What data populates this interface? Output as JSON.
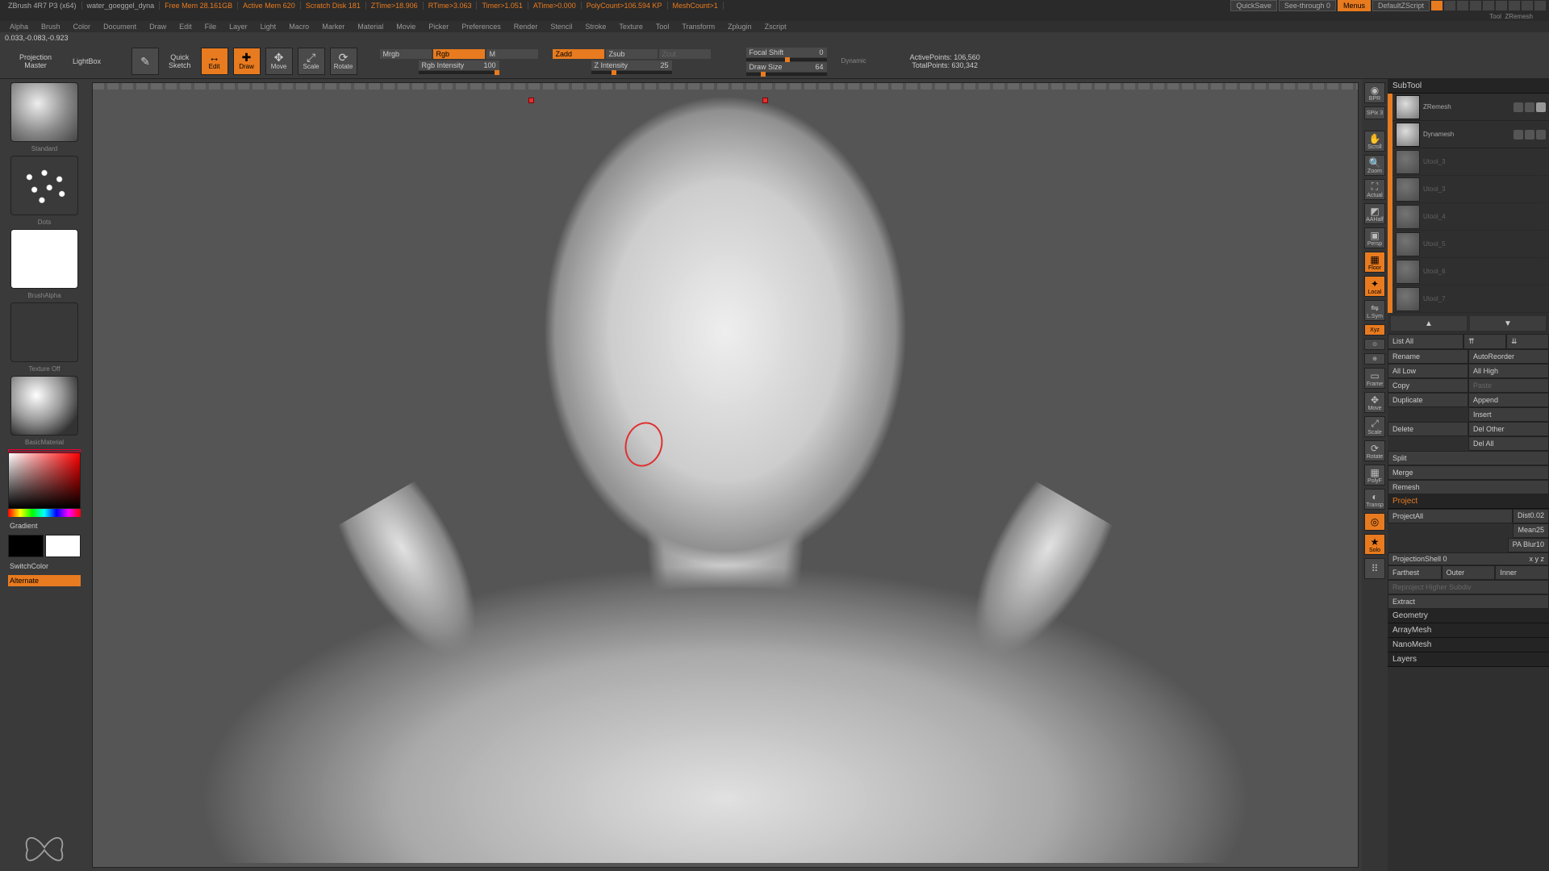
{
  "titlebar": {
    "app": "ZBrush 4R7 P3 (x64)",
    "doc": "water_goeggel_dyna",
    "freemem": "Free Mem 28.161GB",
    "activemem": "Active Mem 620",
    "scratch": "Scratch Disk 181",
    "ztime": "ZTime>18.906",
    "rtime": "RTime>3.063",
    "timer": "Timer>1.051",
    "atime": "ATime>0.000",
    "polycount": "PolyCount>106.594 KP",
    "meshcount": "MeshCount>1",
    "quicksave": "QuickSave",
    "seethrough": "See-through  0",
    "menus": "Menus",
    "script": "DefaultZScript"
  },
  "rightheader": {
    "tool": "Tool",
    "sub": "ZRemesh"
  },
  "menubar": [
    "Alpha",
    "Brush",
    "Color",
    "Document",
    "Draw",
    "Edit",
    "File",
    "Layer",
    "Light",
    "Macro",
    "Marker",
    "Material",
    "Movie",
    "Picker",
    "Preferences",
    "Render",
    "Stencil",
    "Stroke",
    "Texture",
    "Tool",
    "Transform",
    "Zplugin",
    "Zscript"
  ],
  "status": "0.033,-0.083,-0.923",
  "toolbar": {
    "projection": {
      "l1": "Projection",
      "l2": "Master"
    },
    "lightbox": "LightBox",
    "quicksketch": {
      "l1": "Quick",
      "l2": "Sketch"
    },
    "edit": "Edit",
    "draw": "Draw",
    "move": "Move",
    "scale": "Scale",
    "rotate": "Rotate",
    "mrgb": "Mrgb",
    "rgb": "Rgb",
    "m": "M",
    "rgbint_lbl": "Rgb Intensity",
    "rgbint_val": "100",
    "zadd": "Zadd",
    "zsub": "Zsub",
    "zcut": "Zcut",
    "zint_lbl": "Z Intensity",
    "zint_val": "25",
    "focal_lbl": "Focal Shift",
    "focal_val": "0",
    "drawsize_lbl": "Draw Size",
    "drawsize_val": "64",
    "dynamic": "Dynamic",
    "activepts_lbl": "ActivePoints:",
    "activepts_val": "106,560",
    "totalpts_lbl": "TotalPoints:",
    "totalpts_val": "630,342"
  },
  "left": {
    "brush": "Standard",
    "stroke": "Dots",
    "alpha": "BrushAlpha",
    "texture": "Texture Off",
    "material": "BasicMaterial",
    "gradient": "Gradient",
    "switchcolor": "SwitchColor",
    "alternate": "Alternate"
  },
  "iconstrip": {
    "bpr": "BPR",
    "spix": "SPix 3",
    "scroll": "Scroll",
    "zoom": "Zoom",
    "actual": "Actual",
    "aahalf": "AAHalf",
    "persp": "Persp",
    "floor": "Floor",
    "local": "Local",
    "lsym": "L.Sym",
    "xyz": "Xyz",
    "frame": "Frame",
    "move": "Move",
    "scale": "Scale",
    "rotate": "Rotate",
    "polyf": "PolyF",
    "transp": "Transp",
    "solo": "Solo",
    "linefill": "Line Fill",
    "dynamic": "Dynamic"
  },
  "right": {
    "subtool_head": "SubTool",
    "subtools": [
      {
        "name": "ZRemesh"
      },
      {
        "name": "Dynamesh"
      },
      {
        "name": "Utool_3"
      },
      {
        "name": "Utool_3"
      },
      {
        "name": "Utool_4"
      },
      {
        "name": "Utool_5"
      },
      {
        "name": "Utool_6"
      },
      {
        "name": "Utool_7"
      }
    ],
    "listall": "List All",
    "rename": "Rename",
    "autoreorder": "AutoReorder",
    "alllow": "All Low",
    "allhigh": "All High",
    "copy": "Copy",
    "paste": "Paste",
    "duplicate": "Duplicate",
    "append": "Append",
    "insert": "Insert",
    "delete": "Delete",
    "delother": "Del Other",
    "delall": "Del All",
    "split": "Split",
    "merge": "Merge",
    "remesh": "Remesh",
    "project": "Project",
    "projectall": "ProjectAll",
    "dist_lbl": "Dist",
    "dist_val": "0.02",
    "mean_lbl": "Mean",
    "mean_val": "25",
    "blur_lbl": "PA Blur",
    "blur_val": "10",
    "projshell": "ProjectionShell 0",
    "xyz2": "x y z",
    "farthest": "Farthest",
    "outer": "Outer",
    "inner": "Inner",
    "reproject": "Reproject Higher Subdiv",
    "extract": "Extract",
    "geometry": "Geometry",
    "arraymesh": "ArrayMesh",
    "nanomesh": "NanoMesh",
    "layers": "Layers"
  }
}
